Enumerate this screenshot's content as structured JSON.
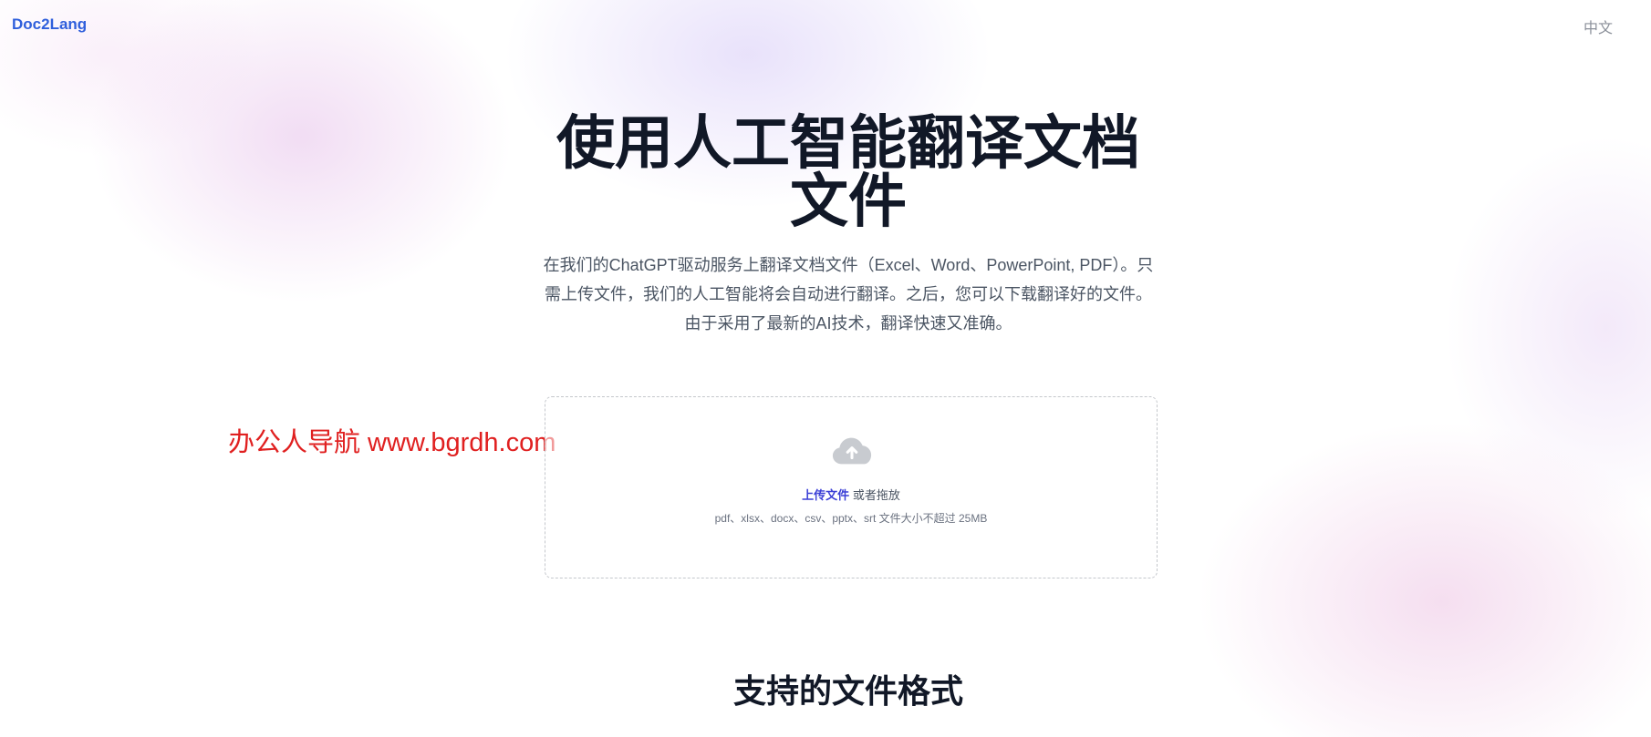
{
  "header": {
    "logo": "Doc2Lang",
    "language": "中文"
  },
  "hero": {
    "title": "使用人工智能翻译文档文件",
    "subtitle": "在我们的ChatGPT驱动服务上翻译文档文件（Excel、Word、PowerPoint, PDF）。只需上传文件，我们的人工智能将会自动进行翻译。之后，您可以下载翻译好的文件。由于采用了最新的AI技术，翻译快速又准确。"
  },
  "watermark": "办公人导航 www.bgrdh.com",
  "upload": {
    "link_label": "上传文件",
    "or_drag": "或者拖放",
    "hint": "pdf、xlsx、docx、csv、pptx、srt 文件大小不超过 25MB",
    "icon": "cloud-upload-icon"
  },
  "sections": {
    "formats_title": "支持的文件格式"
  },
  "colors": {
    "brand": "#2f5fdc",
    "link": "#3b3fd6",
    "watermark": "#e02020"
  }
}
